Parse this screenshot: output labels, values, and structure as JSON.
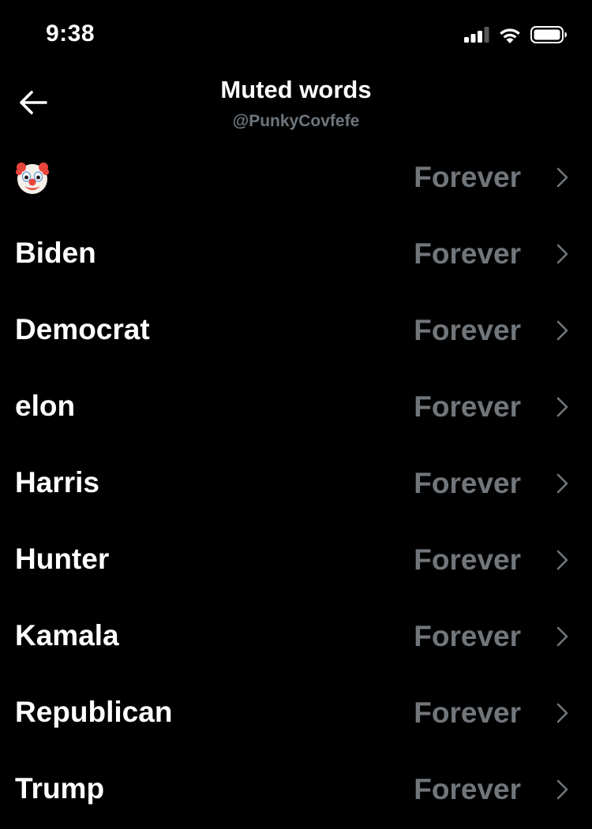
{
  "status_bar": {
    "time": "9:38",
    "icons": [
      "cellular-signal-icon",
      "wifi-icon",
      "battery-icon"
    ]
  },
  "header": {
    "title": "Muted words",
    "subtitle": "@PunkyCovfefe",
    "back_icon": "arrow-left-icon"
  },
  "colors": {
    "background": "#000000",
    "primary_text": "#ffffff",
    "secondary_text": "#71767b"
  },
  "muted_words": [
    {
      "word": "🤡",
      "duration": "Forever",
      "icon": "clown-face-icon"
    },
    {
      "word": "Biden",
      "duration": "Forever"
    },
    {
      "word": "Democrat",
      "duration": "Forever"
    },
    {
      "word": "elon",
      "duration": "Forever"
    },
    {
      "word": "Harris",
      "duration": "Forever"
    },
    {
      "word": "Hunter",
      "duration": "Forever"
    },
    {
      "word": "Kamala",
      "duration": "Forever"
    },
    {
      "word": "Republican",
      "duration": "Forever"
    },
    {
      "word": "Trump",
      "duration": "Forever"
    }
  ]
}
